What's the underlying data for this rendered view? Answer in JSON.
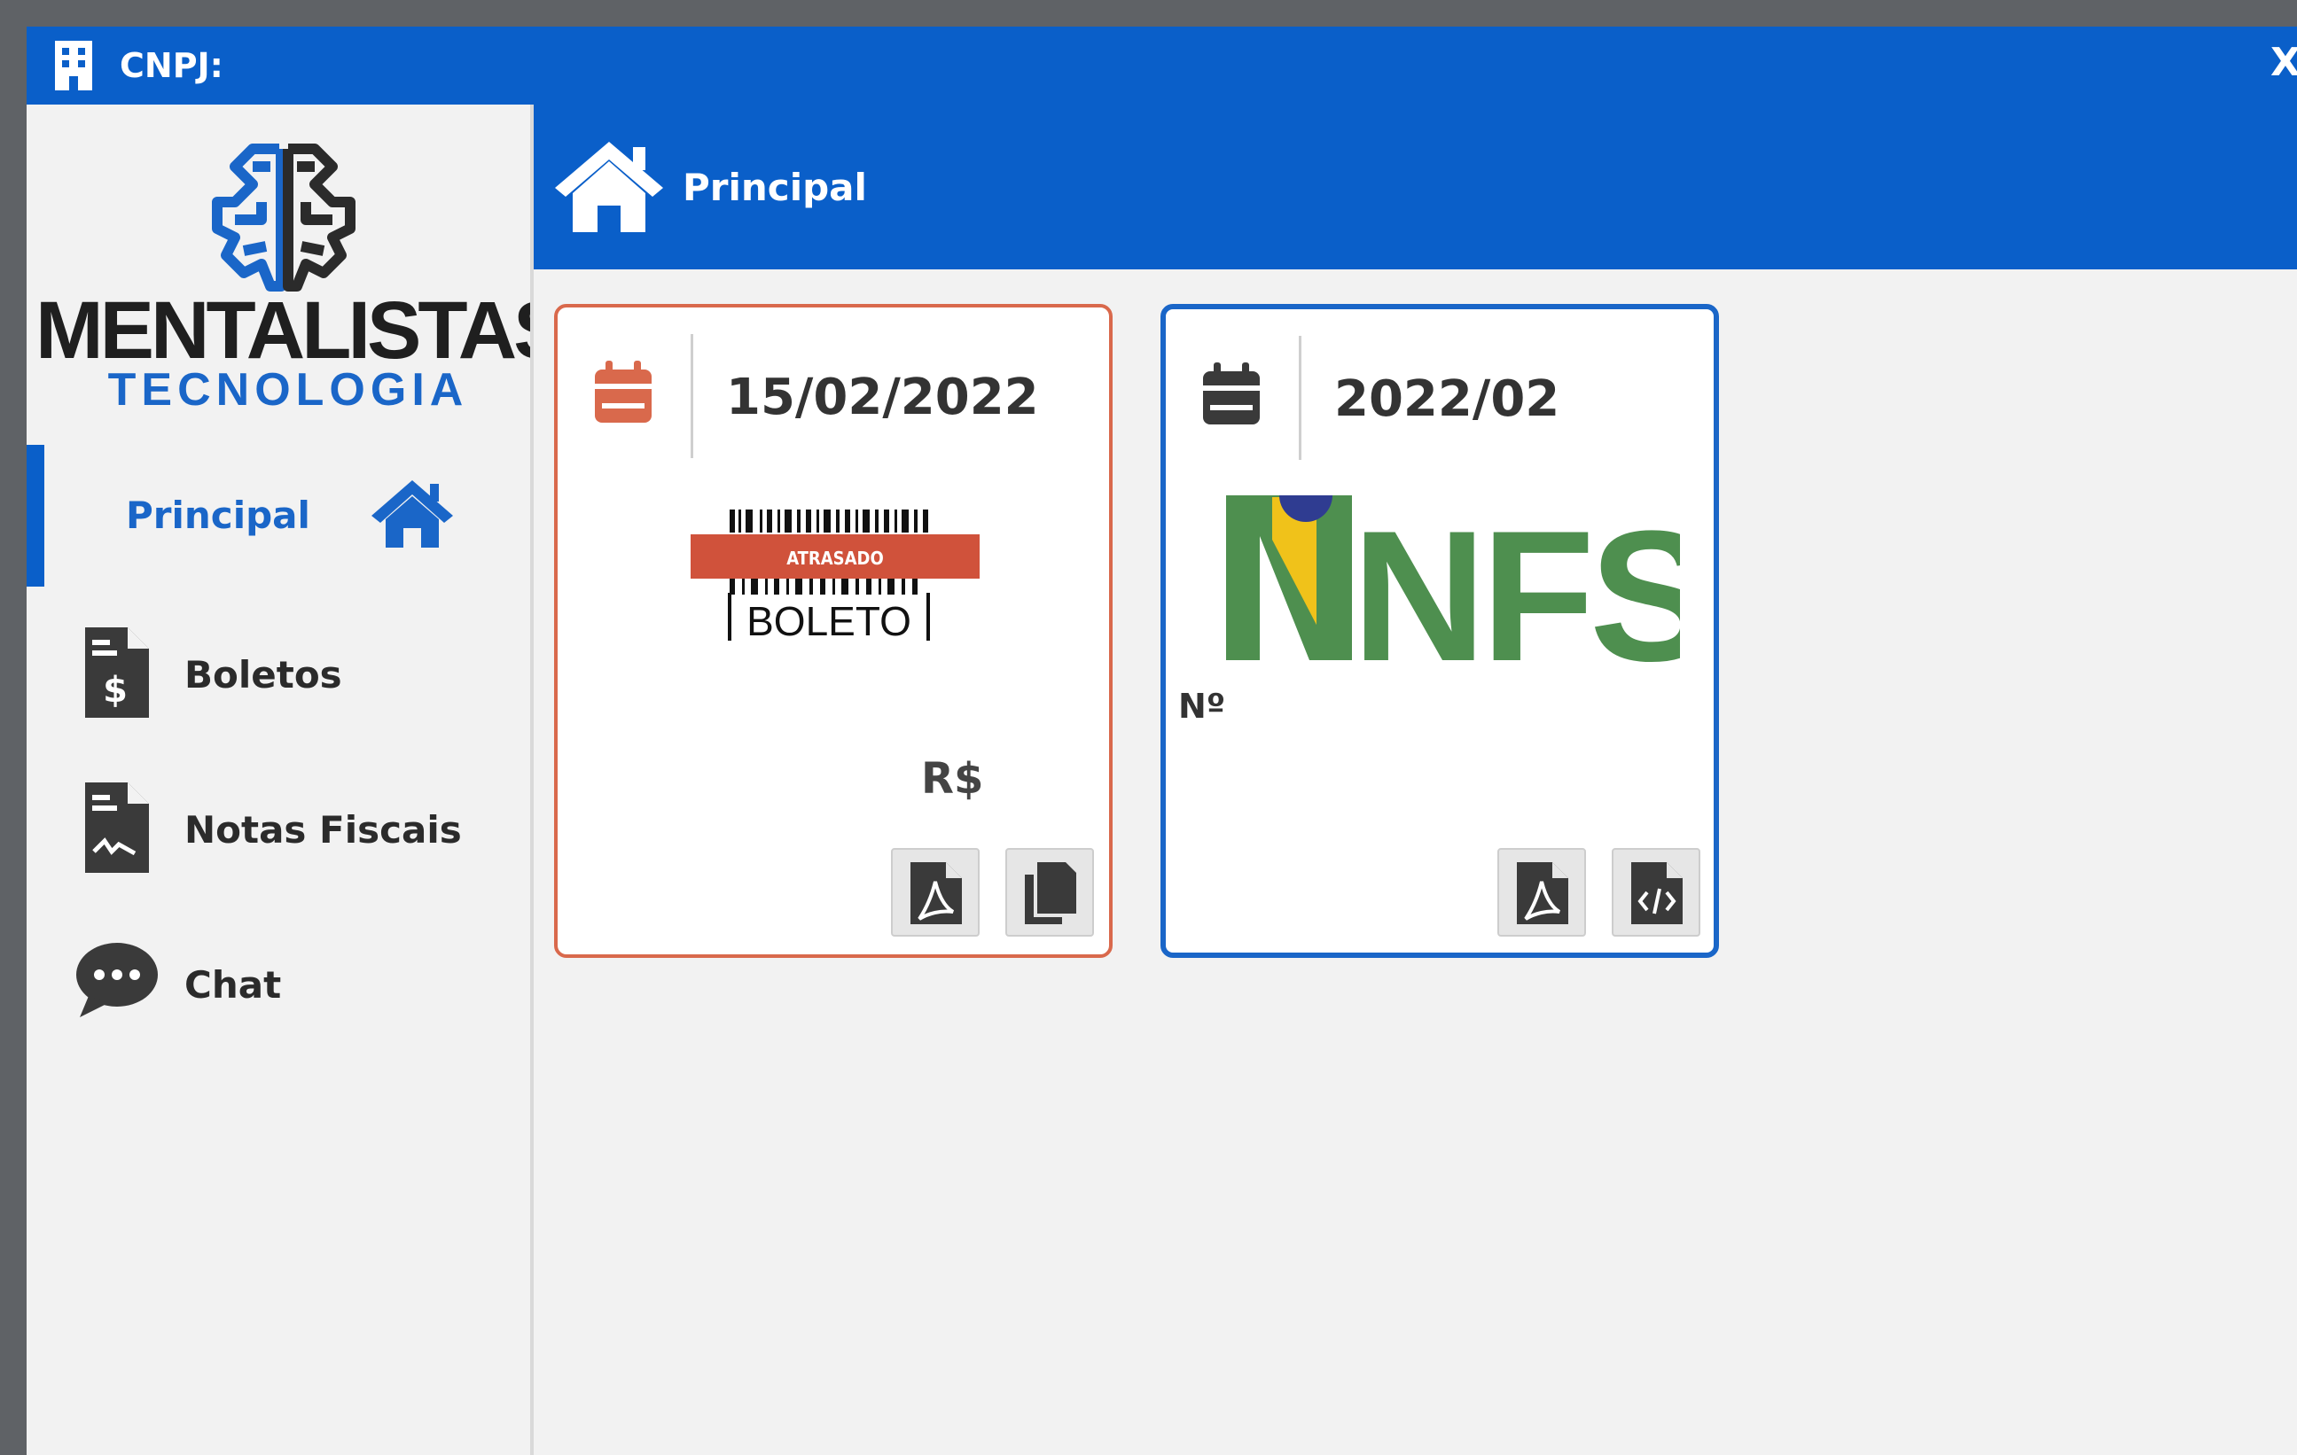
{
  "window": {
    "title": "CNPJ:",
    "close_label": "X",
    "icons": {
      "building": "building-icon"
    }
  },
  "brand": {
    "name": "MENTALISTAS",
    "subtitle": "TECNOLOGIA",
    "colors": {
      "primary": "#0a5fc9",
      "overdue": "#d9694c",
      "text_dark": "#1f1f1f"
    }
  },
  "sidebar": {
    "items": [
      {
        "label": "Principal",
        "icon": "home-icon",
        "active": true
      },
      {
        "label": "Boletos",
        "icon": "boleto-document-icon",
        "active": false
      },
      {
        "label": "Notas Fiscais",
        "icon": "invoice-document-icon",
        "active": false
      },
      {
        "label": "Chat",
        "icon": "chat-bubble-icon",
        "active": false
      }
    ]
  },
  "header": {
    "title": "Principal",
    "icon": "home-icon"
  },
  "cards": {
    "boleto": {
      "date": "15/02/2022",
      "badge": "ATRASADO",
      "image_label": "BOLETO",
      "currency": "R$",
      "actions": [
        "pdf-icon",
        "copy-icon"
      ]
    },
    "nfse": {
      "date": "2022/02",
      "logo_text": "NFSe",
      "number_label": "Nº",
      "actions": [
        "pdf-icon",
        "xml-code-icon"
      ]
    }
  }
}
